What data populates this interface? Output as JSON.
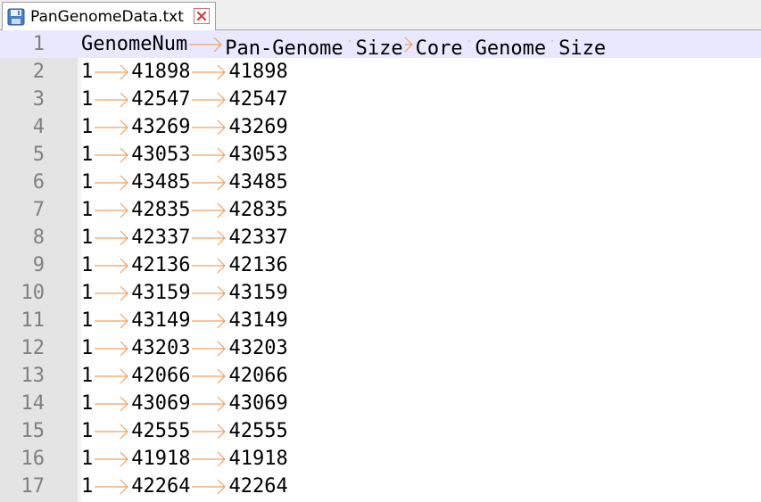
{
  "tab": {
    "filename": "PanGenomeData.txt"
  },
  "colors": {
    "arrow": "#f0a060",
    "current_line": "#e8e8ff",
    "gutter": "#e4e4e4"
  },
  "header": [
    "GenomeNum",
    "Pan-Genome Size",
    "Core Genome Size"
  ],
  "rows": [
    [
      "1",
      "41898",
      "41898"
    ],
    [
      "1",
      "42547",
      "42547"
    ],
    [
      "1",
      "43269",
      "43269"
    ],
    [
      "1",
      "43053",
      "43053"
    ],
    [
      "1",
      "43485",
      "43485"
    ],
    [
      "1",
      "42835",
      "42835"
    ],
    [
      "1",
      "42337",
      "42337"
    ],
    [
      "1",
      "42136",
      "42136"
    ],
    [
      "1",
      "43159",
      "43159"
    ],
    [
      "1",
      "43149",
      "43149"
    ],
    [
      "1",
      "43203",
      "43203"
    ],
    [
      "1",
      "42066",
      "42066"
    ],
    [
      "1",
      "43069",
      "43069"
    ],
    [
      "1",
      "42555",
      "42555"
    ],
    [
      "1",
      "41918",
      "41918"
    ],
    [
      "1",
      "42264",
      "42264"
    ]
  ],
  "line_numbers": [
    "1",
    "2",
    "3",
    "4",
    "5",
    "6",
    "7",
    "8",
    "9",
    "10",
    "11",
    "12",
    "13",
    "14",
    "15",
    "16",
    "17"
  ]
}
